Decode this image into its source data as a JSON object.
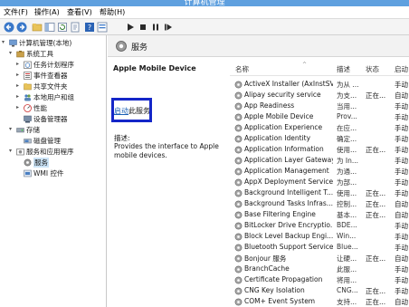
{
  "window": {
    "title": "计算机管理"
  },
  "menu": [
    {
      "label": "文件(F)"
    },
    {
      "label": "操作(A)"
    },
    {
      "label": "查看(V)"
    },
    {
      "label": "帮助(H)"
    }
  ],
  "toolbar": [
    {
      "icon": "back-arrow-icon"
    },
    {
      "icon": "forward-arrow-icon"
    },
    {
      "icon": "up-folder-icon"
    },
    {
      "icon": "show-hide-tree-icon"
    },
    {
      "icon": "refresh-icon"
    },
    {
      "icon": "export-icon"
    },
    {
      "icon": "help-icon"
    },
    {
      "icon": "properties-icon"
    },
    {
      "icon": "play-icon"
    },
    {
      "icon": "stop-icon"
    },
    {
      "icon": "pause-icon"
    },
    {
      "icon": "restart-icon"
    }
  ],
  "tree": [
    {
      "label": "计算机管理(本地)",
      "icon": "computer-management-icon",
      "indent": 0,
      "arrow": "▾"
    },
    {
      "label": "系统工具",
      "icon": "tools-icon",
      "indent": 1,
      "arrow": "▾"
    },
    {
      "label": "任务计划程序",
      "icon": "task-scheduler-icon",
      "indent": 2,
      "arrow": "▸"
    },
    {
      "label": "事件查看器",
      "icon": "event-viewer-icon",
      "indent": 2,
      "arrow": "▸"
    },
    {
      "label": "共享文件夹",
      "icon": "shared-folder-icon",
      "indent": 2,
      "arrow": "▸"
    },
    {
      "label": "本地用户和组",
      "icon": "users-icon",
      "indent": 2,
      "arrow": "▸"
    },
    {
      "label": "性能",
      "icon": "performance-icon",
      "indent": 2,
      "arrow": "▸"
    },
    {
      "label": "设备管理器",
      "icon": "device-manager-icon",
      "indent": 2,
      "arrow": ""
    },
    {
      "label": "存储",
      "icon": "storage-icon",
      "indent": 1,
      "arrow": "▾"
    },
    {
      "label": "磁盘管理",
      "icon": "disk-management-icon",
      "indent": 2,
      "arrow": ""
    },
    {
      "label": "服务和应用程序",
      "icon": "services-apps-icon",
      "indent": 1,
      "arrow": "▾"
    },
    {
      "label": "服务",
      "icon": "services-icon",
      "indent": 2,
      "arrow": "",
      "selected": true
    },
    {
      "label": "WMI 控件",
      "icon": "wmi-control-icon",
      "indent": 2,
      "arrow": ""
    }
  ],
  "content": {
    "header_title": "服务",
    "selected_service": "Apple Mobile Device",
    "start_link": "启动",
    "start_suffix": "此服务",
    "desc_label": "描述:",
    "desc_text": "Provides the interface to Apple mobile devices."
  },
  "columns": {
    "name": "名称",
    "desc": "描述",
    "status": "状态",
    "startup": "启动"
  },
  "services": [
    {
      "name": "ActiveX Installer (AxInstSV)",
      "desc": "为从 ...",
      "status": "",
      "startup": "手动"
    },
    {
      "name": "Alipay security service",
      "desc": "为支...",
      "status": "正在...",
      "startup": "自动"
    },
    {
      "name": "App Readiness",
      "desc": "当用...",
      "status": "",
      "startup": "手动"
    },
    {
      "name": "Apple Mobile Device",
      "desc": "Prov...",
      "status": "",
      "startup": "手动"
    },
    {
      "name": "Application Experience",
      "desc": "在应...",
      "status": "",
      "startup": "手动"
    },
    {
      "name": "Application Identity",
      "desc": "确定...",
      "status": "",
      "startup": "手动"
    },
    {
      "name": "Application Information",
      "desc": "使用...",
      "status": "正在...",
      "startup": "手动"
    },
    {
      "name": "Application Layer Gateway...",
      "desc": "为 In...",
      "status": "",
      "startup": "手动"
    },
    {
      "name": "Application Management",
      "desc": "为通...",
      "status": "",
      "startup": "手动"
    },
    {
      "name": "AppX Deployment Service...",
      "desc": "为部...",
      "status": "",
      "startup": "手动"
    },
    {
      "name": "Background Intelligent T...",
      "desc": "使用...",
      "status": "正在...",
      "startup": "手动"
    },
    {
      "name": "Background Tasks Infras...",
      "desc": "控制...",
      "status": "正在...",
      "startup": "自动"
    },
    {
      "name": "Base Filtering Engine",
      "desc": "基本...",
      "status": "正在...",
      "startup": "自动"
    },
    {
      "name": "BitLocker Drive Encryptio...",
      "desc": "BDE...",
      "status": "",
      "startup": "手动"
    },
    {
      "name": "Block Level Backup Engi...",
      "desc": "Win...",
      "status": "",
      "startup": "手动"
    },
    {
      "name": "Bluetooth Support Service",
      "desc": "Blue...",
      "status": "",
      "startup": "手动"
    },
    {
      "name": "Bonjour 服务",
      "desc": "让硬...",
      "status": "正在...",
      "startup": "自动"
    },
    {
      "name": "BranchCache",
      "desc": "此服...",
      "status": "",
      "startup": "手动"
    },
    {
      "name": "Certificate Propagation",
      "desc": "将用...",
      "status": "",
      "startup": "手动"
    },
    {
      "name": "CNG Key Isolation",
      "desc": "CNG...",
      "status": "正在...",
      "startup": "手动"
    },
    {
      "name": "COM+ Event System",
      "desc": "支持...",
      "status": "正在...",
      "startup": "自动"
    }
  ]
}
